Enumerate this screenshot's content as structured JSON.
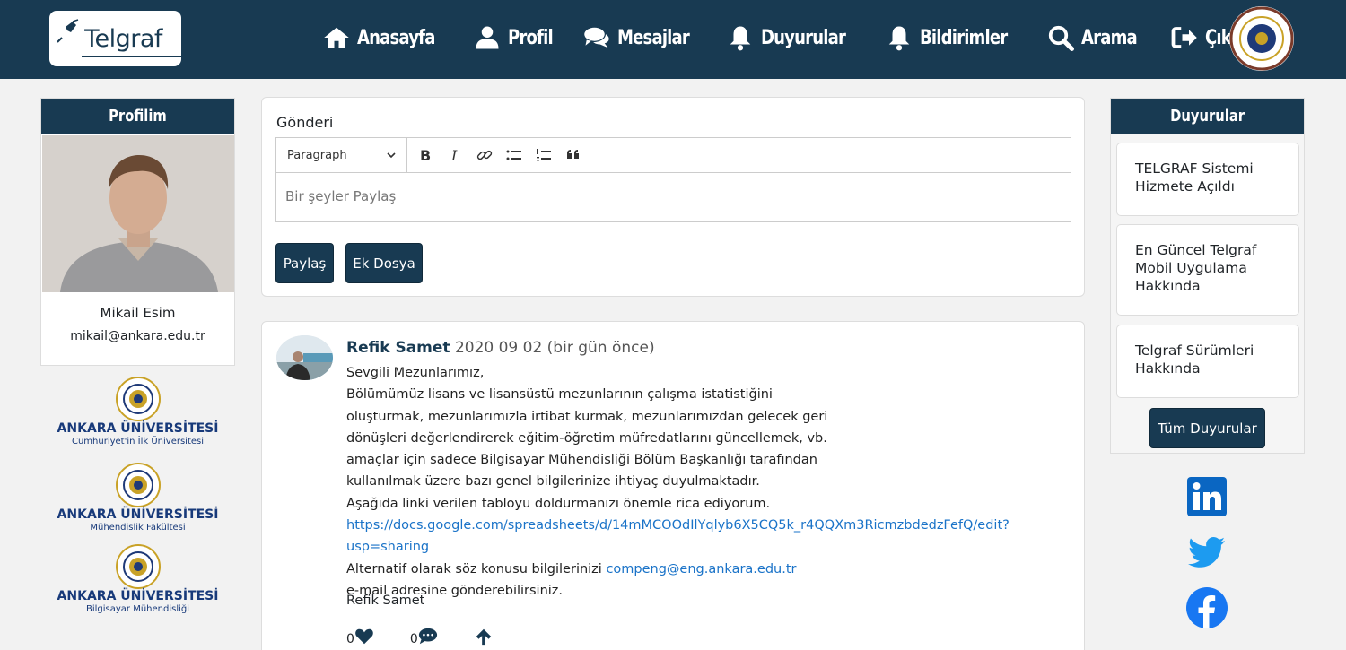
{
  "nav": {
    "logo_text": "Telgraf",
    "items": [
      {
        "label": "Anasayfa",
        "icon": "home-icon"
      },
      {
        "label": "Profil",
        "icon": "user-icon"
      },
      {
        "label": "Mesajlar",
        "icon": "comments-icon"
      },
      {
        "label": "Duyurular",
        "icon": "bell-icon"
      },
      {
        "label": "Bildirimler",
        "icon": "bell-icon"
      },
      {
        "label": "Arama",
        "icon": "search-icon"
      },
      {
        "label": "Çıkış",
        "icon": "sign-out-icon"
      }
    ],
    "seal_icon": "ankara-university-seal-icon"
  },
  "profile": {
    "title": "Profilim",
    "name": "Mikail Esim",
    "email": "mikail@ankara.edu.tr"
  },
  "uni_logos": [
    {
      "name": "ANKARA ÜNİVERSİTESİ",
      "sub": "Cumhuriyet'in İlk Üniversitesi"
    },
    {
      "name": "ANKARA ÜNİVERSİTESİ",
      "sub": "Mühendislik Fakültesi"
    },
    {
      "name": "ANKARA ÜNİVERSİTESİ",
      "sub": "Bilgisayar Mühendisliği"
    }
  ],
  "composer": {
    "title": "Gönderi",
    "paragraph_select": "Paragraph",
    "placeholder": "Bir şeyler Paylaş",
    "share_button": "Paylaş",
    "attach_button": "Ek Dosya"
  },
  "post": {
    "author": "Refik Samet",
    "date": "2020 09 02 (bir gün önce)",
    "lines": [
      "Sevgili Mezunlarımız,",
      "Bölümümüz lisans ve lisansüstü mezunlarının çalışma istatistiğini",
      "oluşturmak, mezunlarımızla irtibat kurmak, mezunlarımızdan gelecek geri",
      "dönüşleri değerlendirerek eğitim-öğretim müfredatlarını güncellemek, vb.",
      "amaçlar için sadece Bilgisayar Mühendisliği Bölüm Başkanlığı tarafından",
      "kullanılmak üzere bazı genel bilgilerinize ihtiyaç duyulmaktadır.",
      "Aşağıda linki verilen tabloyu doldurmanızı önemle rica ediyorum."
    ],
    "link": "https://docs.google.com/spreadsheets/d/14mMCOOdIlYqlyb6X5CQ5k_r4QQXm3RicmzbdedzFefQ/edit?usp=sharing",
    "alt_prefix": "Alternatif olarak söz konusu bilgilerinizi ",
    "alt_email": "compeng@eng.ankara.edu.tr",
    "alt_suffix": "e-mail adresine gönderebilirsiniz.",
    "signature": "Refik Samet",
    "likes": "0",
    "comments": "0"
  },
  "announcements": {
    "title": "Duyurular",
    "items": [
      "TELGRAF Sistemi Hizmete Açıldı",
      "En Güncel Telgraf Mobil Uygulama Hakkında",
      "Telgraf Sürümleri Hakkında"
    ],
    "all_button": "Tüm Duyurular"
  },
  "social": [
    "linkedin-icon",
    "twitter-icon",
    "facebook-icon"
  ],
  "colors": {
    "brand": "#183a52",
    "link": "#1a73c8",
    "university_blue": "#183a7a"
  }
}
